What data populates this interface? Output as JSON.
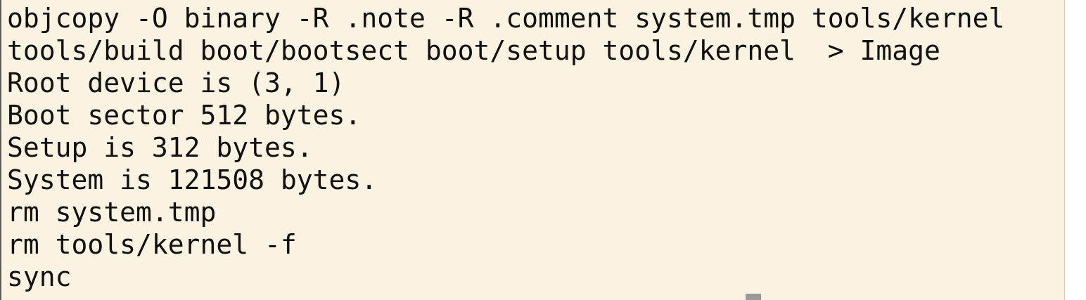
{
  "terminal": {
    "partial_top_line": "",
    "lines": [
      "objcopy -O binary -R .note -R .comment system.tmp tools/kernel",
      "tools/build boot/bootsect boot/setup tools/kernel  > Image",
      "Root device is (3, 1)",
      "Boot sector 512 bytes.",
      "Setup is 312 bytes.",
      "System is 121508 bytes.",
      "rm system.tmp",
      "rm tools/kernel -f",
      "sync"
    ],
    "partial_bottom_line": ""
  },
  "colors": {
    "background": "#fbf3e2",
    "text": "#111111",
    "cursor": "#9a9a9a"
  }
}
